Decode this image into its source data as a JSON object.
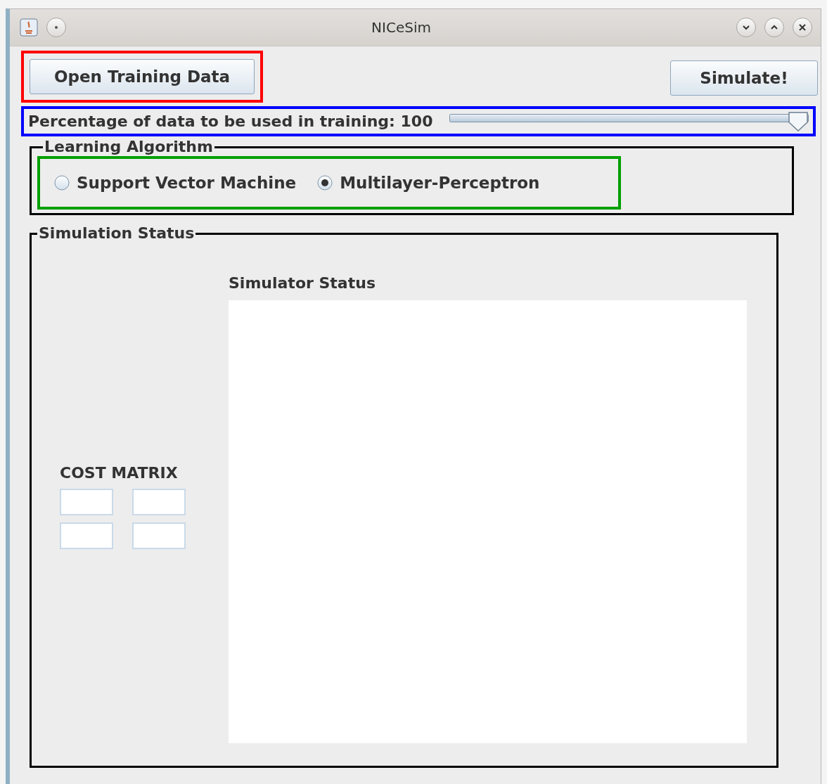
{
  "window": {
    "title": "NICeSim"
  },
  "highlights": [
    {
      "color": "#ff0000"
    },
    {
      "color": "#0000ff"
    },
    {
      "color": "#00a000"
    }
  ],
  "open_button": {
    "label": "Open Training Data"
  },
  "simulate_button": {
    "label": "Simulate!"
  },
  "training_share": {
    "label": "Percentage of data to be used in training: 100",
    "level": 1.0
  },
  "learning_algorithm": {
    "title": "Learning Algorithm",
    "options": [
      {
        "label": "Support Vector Machine",
        "selected": false
      },
      {
        "label": "Multilayer-Perceptron",
        "selected": true
      }
    ]
  },
  "simulation_status": {
    "title": "Simulation Status",
    "cost_matrix": {
      "label": "COST MATRIX",
      "cells": [
        {},
        {},
        {},
        {}
      ]
    },
    "simulator_status": {
      "label": "Simulator Status"
    }
  }
}
